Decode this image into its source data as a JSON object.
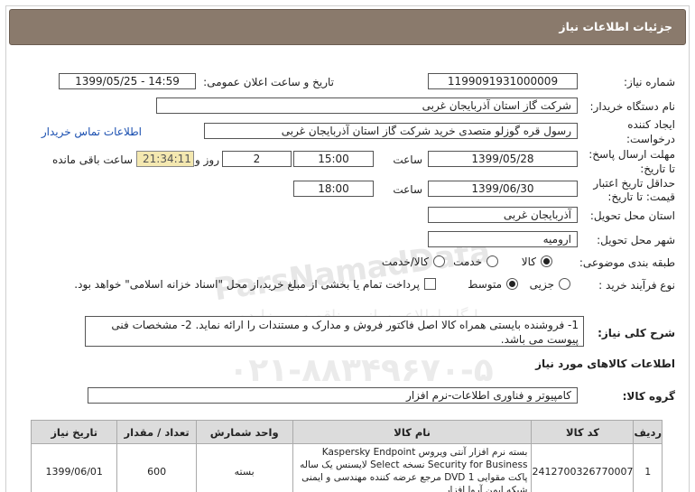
{
  "header": {
    "title": "جزئیات اطلاعات نیاز"
  },
  "need_number": {
    "label": "شماره نیاز:",
    "value": "1199091931000009"
  },
  "announce_datetime": {
    "label": "تاریخ و ساعت اعلان عمومی:",
    "value": "1399/05/25 - 14:59"
  },
  "buyer_org": {
    "label": "نام دستگاه خریدار:",
    "value": "شرکت گاز استان آذربایجان غربی"
  },
  "creator": {
    "label_line1": "ایجاد کننده",
    "label_line2": "درخواست:",
    "value": "رسول قره گوزلو متصدی خرید شرکت گاز استان آذربایجان غربی",
    "contact_link": "اطلاعات تماس خریدار"
  },
  "reply_deadline": {
    "label_line1": "مهلت ارسال پاسخ:",
    "label_line2": "تا تاریخ:",
    "date": "1399/05/28",
    "time_label": "ساعت",
    "time": "15:00",
    "days": "2",
    "days_label": "روز و",
    "remaining": "21:34:11",
    "remaining_label": "ساعت باقی مانده"
  },
  "price_validity": {
    "label_line1": "حداقل تاریخ اعتبار",
    "label_line2": "قیمت: تا تاریخ:",
    "date": "1399/06/30",
    "time_label": "ساعت",
    "time": "18:00"
  },
  "delivery_province": {
    "label": "استان محل تحویل:",
    "value": "آذربایجان غربی"
  },
  "delivery_city": {
    "label": "شهر محل تحویل:",
    "value": "ارومیه"
  },
  "category": {
    "label": "طبقه بندی موضوعی:",
    "options": [
      "کالا",
      "خدمت",
      "کالا/خدمت"
    ],
    "selected": "کالا"
  },
  "purchase_process": {
    "label": "نوع فرآیند خرید :",
    "options": [
      "جزیی",
      "متوسط"
    ],
    "selected": "متوسط",
    "treasury_note": "پرداخت تمام یا بخشی از مبلغ خرید،از محل \"اسناد خزانه اسلامی\" خواهد بود."
  },
  "description": {
    "label": "شرح کلی نیاز:",
    "value": "1- فروشنده بایستی همراه کالا اصل فاکتور فروش و مدارک و مستندات را ارائه نماید. 2- مشخصات فنی پیوست می باشد."
  },
  "goods_section": {
    "title": "اطلاعات کالاهای مورد نیاز"
  },
  "goods_group": {
    "label": "گروه کالا:",
    "value": "کامپیوتر و فناوری اطلاعات-نرم افزار"
  },
  "watermark": {
    "line1": "ParsNamadData",
    "line2": "پایگاه اطلاع رسانی مناقصه و مزایده",
    "line3": "۰۲۱-۸۸۳۴۹۶۷۰-۵"
  },
  "table": {
    "headers": [
      "ردیف",
      "کد کالا",
      "نام کالا",
      "واحد شمارش",
      "تعداد / مقدار",
      "تاریخ نیاز"
    ],
    "rows": [
      [
        "1",
        "2412700326770007",
        "بسته نرم افزار آنتی ویروس Kaspersky Endpoint Security for Business نسخه Select لایسنس یک ساله پاکت مقوایی DVD 1 مرجع عرضه کننده مهندسی و ایمنی شبکه ایمن آروا افزار",
        "بسته",
        "600",
        "1399/06/01"
      ]
    ]
  }
}
